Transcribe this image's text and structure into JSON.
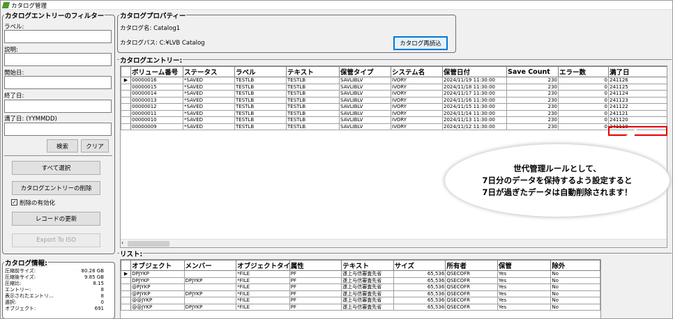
{
  "window": {
    "title": "カタログ管理"
  },
  "filter": {
    "title": "カタログエントリーのフィルター",
    "label_label": "ラベル:",
    "desc_label": "説明:",
    "start_label": "開始日:",
    "end_label": "終了日:",
    "expiry_label": "満了日: (YYMMDD)",
    "search_button": "検索",
    "clear_button": "クリア"
  },
  "actions": {
    "select_all": "すべて選択",
    "delete_entries": "カタログエントリーの削除",
    "enable_delete": "削除の有効化",
    "update_records": "レコードの更新",
    "export": "Export To ISO"
  },
  "catalog_info": {
    "title": "カタログ情報:",
    "rows": [
      {
        "label": "圧縮前サイズ:",
        "value": "80.28 GB"
      },
      {
        "label": "圧縮後サイズ:",
        "value": "9.85 GB"
      },
      {
        "label": "圧縮比:",
        "value": "8.15"
      },
      {
        "label": "エントリー:",
        "value": "8"
      },
      {
        "label": "表示されたエントリ...",
        "value": "8"
      },
      {
        "label": "選択:",
        "value": "0"
      },
      {
        "label": "オブジェクト:",
        "value": "691"
      }
    ]
  },
  "properties": {
    "title": "カタログプロパティー",
    "name_line": "カタログ名: Catalog1",
    "path_line": "カタログパス: C:¥LVB Catalog",
    "reload_button": "カタログ再読込"
  },
  "entries": {
    "title": "カタログエントリー:",
    "columns": [
      "ボリューム番号",
      "ステータス",
      "ラベル",
      "テキスト",
      "保管タイプ",
      "システム名",
      "保管日付",
      "Save Count",
      "エラー数",
      "満了日"
    ],
    "rows": [
      [
        "00000016",
        "*SAVED",
        "TESTLB",
        "TESTLB",
        "SAVLIBLV",
        "IVORY",
        "2024/11/19 11:30:00",
        "230",
        "0",
        "241126"
      ],
      [
        "00000015",
        "*SAVED",
        "TESTLB",
        "TESTLB",
        "SAVLIBLV",
        "IVORY",
        "2024/11/18 11:30:00",
        "230",
        "0",
        "241125"
      ],
      [
        "00000014",
        "*SAVED",
        "TESTLB",
        "TESTLB",
        "SAVLIBLV",
        "IVORY",
        "2024/11/17 11:30:00",
        "230",
        "0",
        "241124"
      ],
      [
        "00000013",
        "*SAVED",
        "TESTLB",
        "TESTLB",
        "SAVLIBLV",
        "IVORY",
        "2024/11/16 11:30:00",
        "230",
        "0",
        "241123"
      ],
      [
        "00000012",
        "*SAVED",
        "TESTLB",
        "TESTLB",
        "SAVLIBLV",
        "IVORY",
        "2024/11/15 11:30:00",
        "230",
        "0",
        "241122"
      ],
      [
        "00000011",
        "*SAVED",
        "TESTLB",
        "TESTLB",
        "SAVLIBLV",
        "IVORY",
        "2024/11/14 11:30:00",
        "230",
        "0",
        "241121"
      ],
      [
        "00000010",
        "*SAVED",
        "TESTLB",
        "TESTLB",
        "SAVLIBLV",
        "IVORY",
        "2024/11/13 11:30:00",
        "230",
        "0",
        "241120"
      ],
      [
        "00000009",
        "*SAVED",
        "TESTLB",
        "TESTLB",
        "SAVLIBLV",
        "IVORY",
        "2024/11/12 11:30:00",
        "230",
        "0",
        "241119"
      ]
    ]
  },
  "callout": {
    "lines": [
      "世代管理ルールとして、",
      "7日分のデータを保持するよう設定すると",
      "7日が過ぎたデータは自動削除されます！"
    ]
  },
  "list": {
    "title": "リスト:",
    "columns": [
      "オブジェクト",
      "メンバー",
      "オブジェクトタイプ",
      "属性",
      "テキスト",
      "サイズ",
      "所有者",
      "保管",
      "除外"
    ],
    "rows": [
      [
        "DPJYKP",
        "",
        "*FILE",
        "PF",
        "遂上与信審査先省",
        "65,536",
        "QSECOFR",
        "Yes",
        "No"
      ],
      [
        "DPJYKP",
        "DPJYKP",
        "*FILE",
        "PF",
        "遂上与信審査先省",
        "65,536",
        "QSECOFR",
        "Yes",
        "No"
      ],
      [
        "@PJYKP",
        "",
        "*FILE",
        "PF",
        "遂上与信審査先省",
        "65,536",
        "QSECOFR",
        "Yes",
        "No"
      ],
      [
        "@PJYKP",
        "DPJYKP",
        "*FILE",
        "PF",
        "遂上与信審査先省",
        "65,536",
        "QSECOFR",
        "Yes",
        "No"
      ],
      [
        "@@JYKP",
        "",
        "*FILE",
        "PF",
        "遂上与信審査先省",
        "65,536",
        "QSECOFR",
        "Yes",
        "No"
      ],
      [
        "@@JYKP",
        "DPJYKP",
        "*FILE",
        "PF",
        "遂上与信審査先省",
        "65,536",
        "QSECOFR",
        "Yes",
        "No"
      ]
    ]
  },
  "colors": {
    "highlight": "#e60000",
    "accent": "#0078d7"
  }
}
